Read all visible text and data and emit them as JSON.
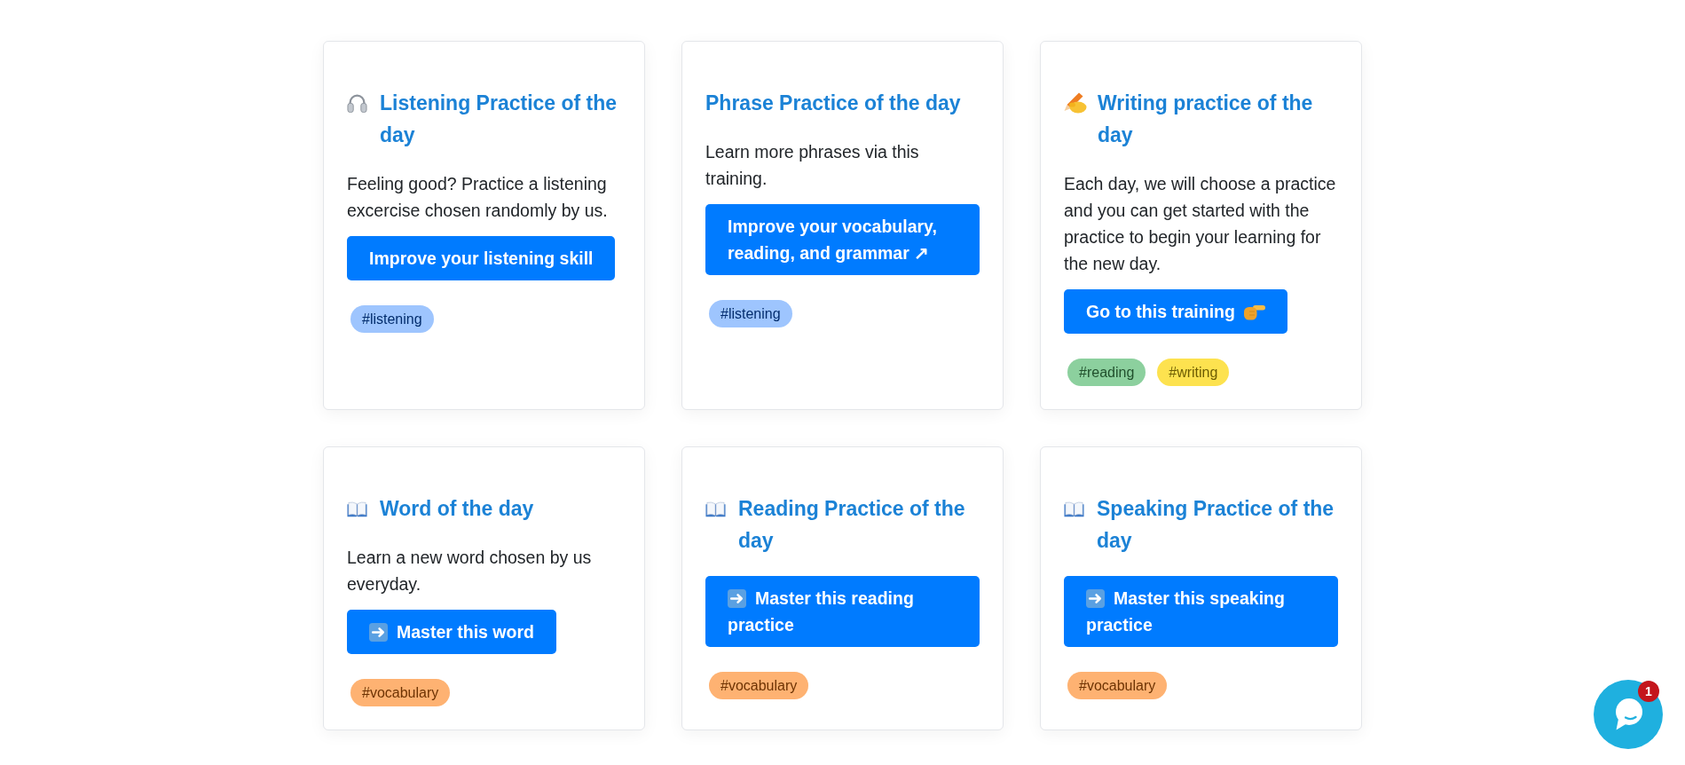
{
  "cards": [
    {
      "kind": "listening",
      "title": "Listening Practice of the day",
      "description": "Feeling good? Practice a listening excercise chosen randomly by us.",
      "button": "Improve your listening skill",
      "tags": [
        {
          "label": "#listening",
          "color": "#9ec5fe"
        }
      ]
    },
    {
      "kind": "phrase",
      "title": "Phrase Practice of the day",
      "description": "Learn more phrases via this training.",
      "button": "Improve your vocabulary, reading, and grammar ↗",
      "tags": [
        {
          "label": "#listening",
          "color": "#9ec5fe"
        }
      ]
    },
    {
      "kind": "writing",
      "title": "Writing practice of the day",
      "description": "Each day, we will choose a practice and you can get started with the practice to begin your learning for the new day.",
      "button": "Go to this training",
      "tags": [
        {
          "label": "#reading",
          "color": "#8cd09e"
        },
        {
          "label": "#writing",
          "color": "#fde24f"
        }
      ]
    },
    {
      "kind": "word",
      "title": "Word of the day",
      "description": "Learn a new word chosen by us everyday.",
      "button": "Master this word",
      "tags": [
        {
          "label": "#vocabulary",
          "color": "#feb272"
        }
      ]
    },
    {
      "kind": "reading",
      "title": "Reading Practice of the day",
      "button": "Master this reading practice",
      "tags": [
        {
          "label": "#vocabulary",
          "color": "#feb272"
        }
      ]
    },
    {
      "kind": "speaking",
      "title": "Speaking Practice of the day",
      "button": "Master this speaking practice",
      "tags": [
        {
          "label": "#vocabulary",
          "color": "#feb272"
        }
      ]
    }
  ],
  "chat_widget": {
    "badge": "1"
  }
}
